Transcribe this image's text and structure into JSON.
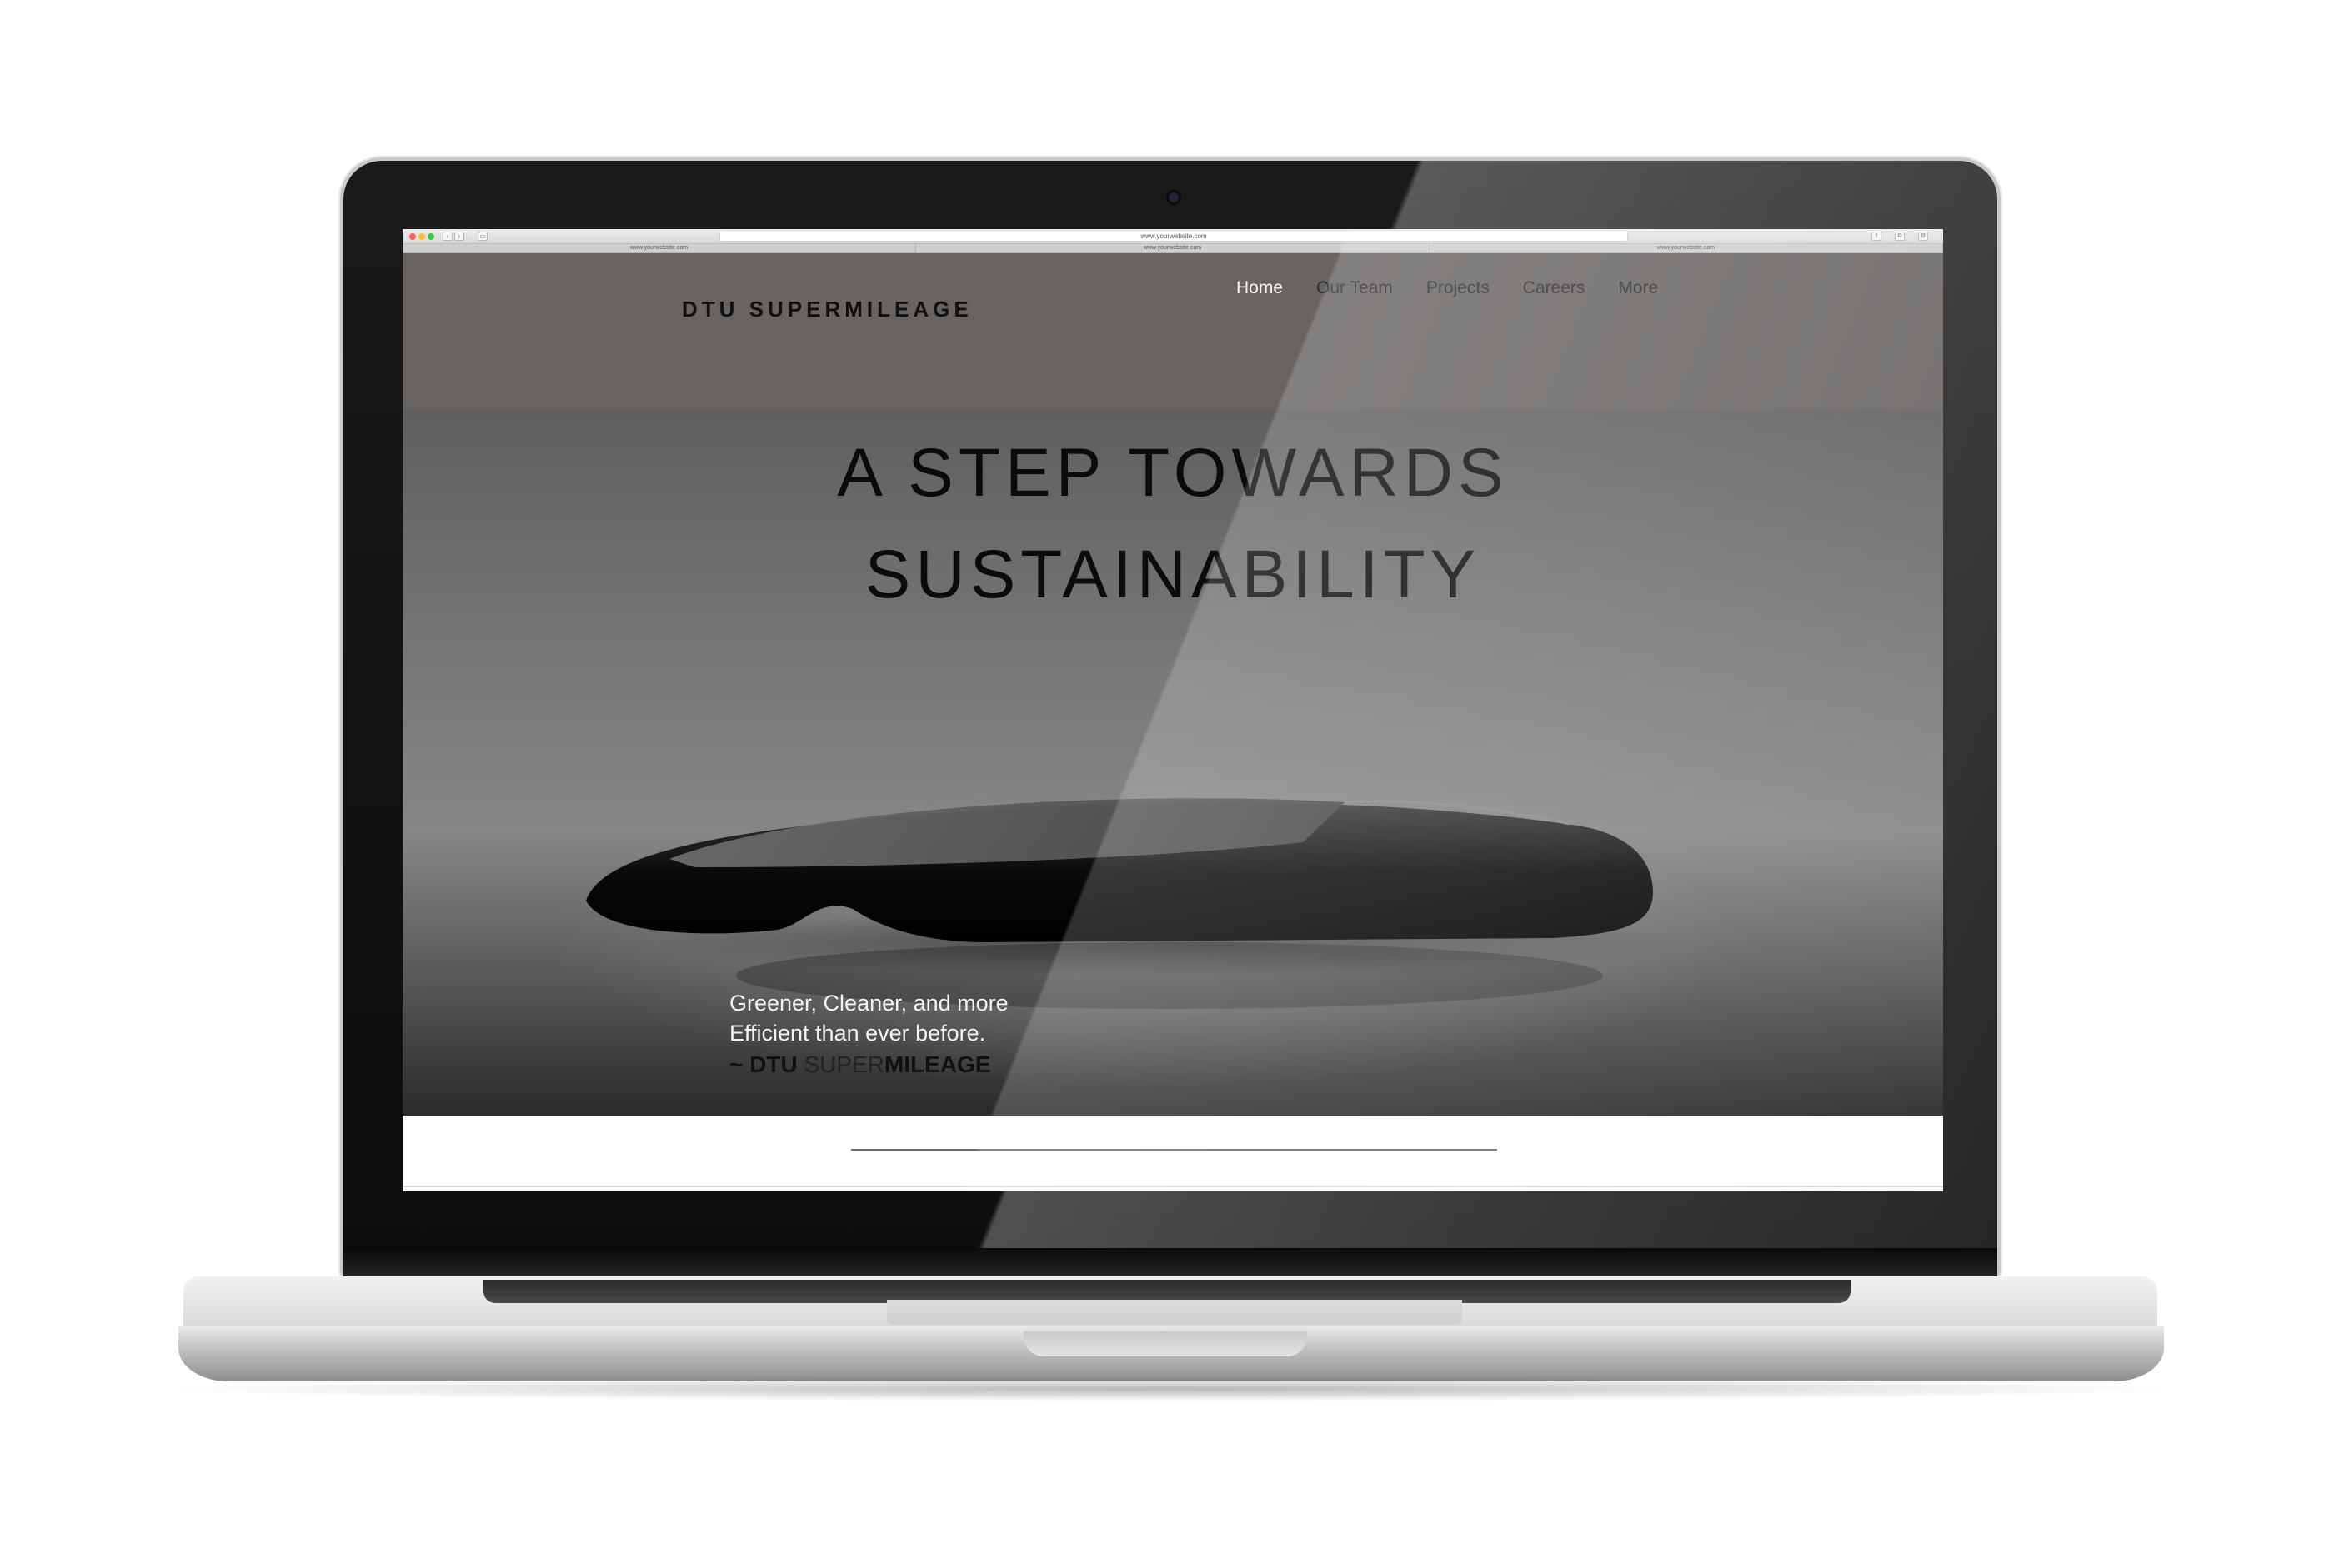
{
  "browser": {
    "address": "www.yourwebsite.com",
    "tabs": [
      "www.yourwebsite.com",
      "www.yourwebsite.com",
      "www.yourwebsite.com"
    ]
  },
  "site": {
    "logo": "DTU SUPERMILEAGE",
    "nav": {
      "home": "Home",
      "our_team": "Our Team",
      "projects": "Projects",
      "careers": "Careers",
      "more": "More"
    },
    "hero": {
      "title_line1": "A STEP TOWARDS",
      "title_line2": "SUSTAINABILITY",
      "tagline_line1": "Greener, Cleaner, and more",
      "tagline_line2": "Efficient than ever before.",
      "signature_prefix": "~ DTU ",
      "signature_light": "SUPER",
      "signature_bold": "MILEAGE"
    }
  },
  "colors": {
    "header_bg": "#676462",
    "nav_active": "#f4f4f4",
    "nav_inactive": "#2f2f2f"
  }
}
